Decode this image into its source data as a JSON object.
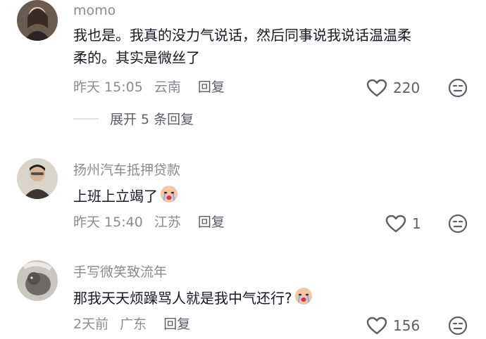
{
  "comments": [
    {
      "username": "momo",
      "text_line1": "我也是。我真的没力气说话，然后同事说我说话温温柔",
      "text_line2": "柔的。其实是微丝了",
      "time": "昨天 15:05",
      "location": "云南",
      "reply_label": "回复",
      "likes": "220"
    },
    {
      "username": "扬州汽车抵押贷款",
      "text": "上班上立竭了",
      "time": "昨天 15:40",
      "location": "江苏",
      "reply_label": "回复",
      "likes": "1"
    },
    {
      "username": "手写微笑致流年",
      "text": "那我天天烦躁骂人就是我中气还行?",
      "time": "2天前",
      "location": "广东",
      "reply_label": "回复",
      "likes": "156"
    }
  ],
  "expand_replies": "展开 5 条回复",
  "colors": {
    "meta_gray": "#8a8b91",
    "text_dark": "#161823",
    "divider": "#e3e3e6"
  },
  "icons": [
    "heart-outline-icon",
    "dislike-face-icon",
    "crying-emoji-icon"
  ]
}
